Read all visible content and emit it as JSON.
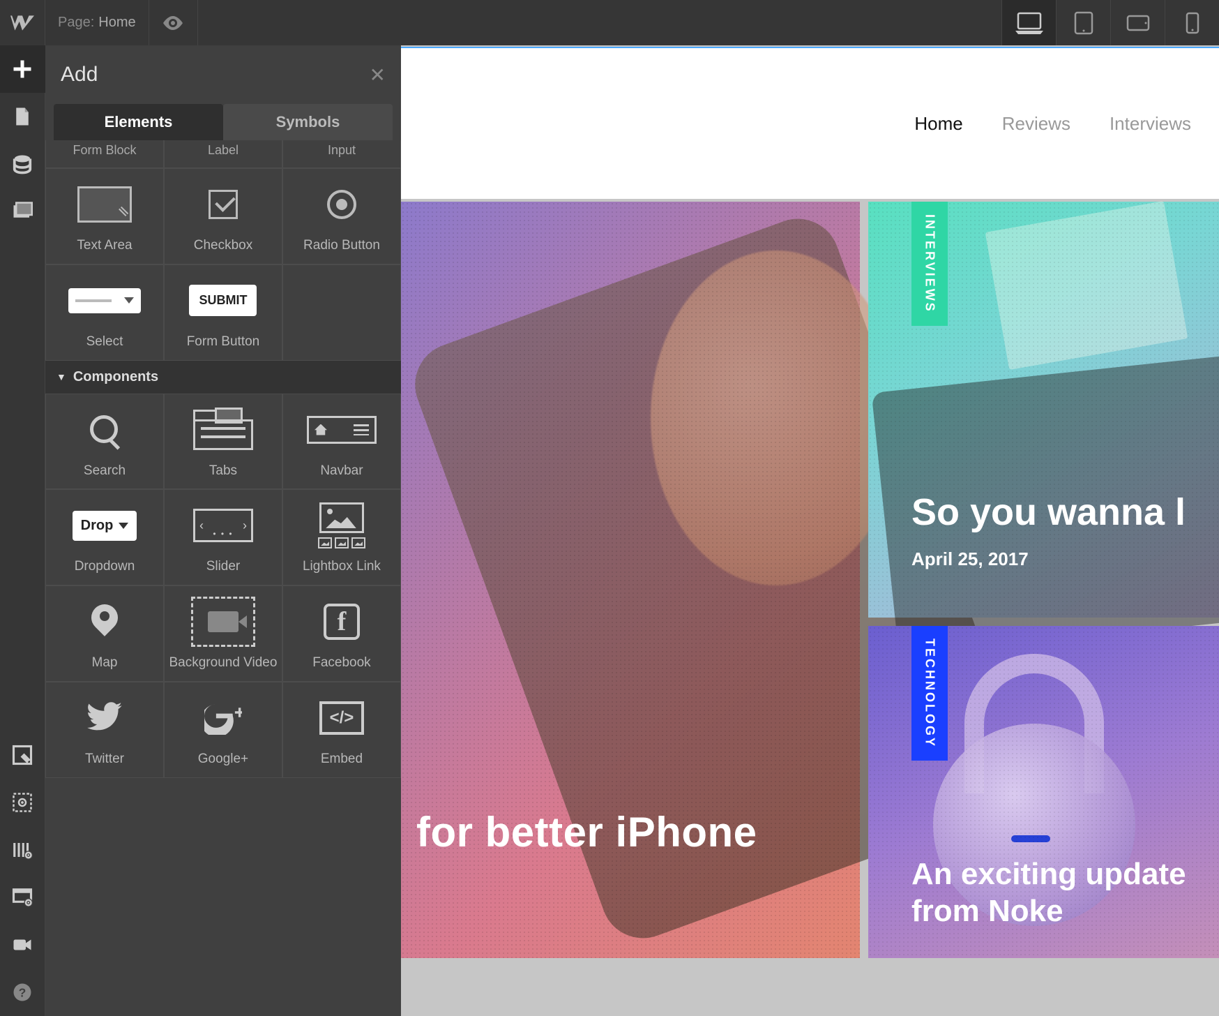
{
  "topbar": {
    "page_label_prefix": "Page:",
    "page_name": "Home"
  },
  "panel": {
    "title": "Add",
    "tabs": {
      "elements": "Elements",
      "symbols": "Symbols"
    },
    "row1": {
      "formblock": "Form Block",
      "label": "Label",
      "input": "Input"
    },
    "row2": {
      "textarea": "Text Area",
      "checkbox": "Checkbox",
      "radio": "Radio Button"
    },
    "row3": {
      "select": "Select",
      "formbutton": "Form Button",
      "submit_text": "SUBMIT"
    },
    "section_components": "Components",
    "row4": {
      "search": "Search",
      "tabs": "Tabs",
      "navbar": "Navbar"
    },
    "row5": {
      "dropdown": "Dropdown",
      "dropdown_btn": "Drop",
      "slider": "Slider",
      "lightbox": "Lightbox Link"
    },
    "row6": {
      "map": "Map",
      "bgvideo": "Background Video",
      "facebook": "Facebook"
    },
    "row7": {
      "twitter": "Twitter",
      "gplus": "Google+",
      "embed": "Embed"
    }
  },
  "site": {
    "nav": {
      "home": "Home",
      "reviews": "Reviews",
      "interviews": "Interviews"
    },
    "hero": {
      "headline": "for better iPhone"
    },
    "card1": {
      "tag": "INTERVIEWS",
      "headline": "So you wanna l",
      "date": "April 25, 2017"
    },
    "card2": {
      "tag": "TECHNOLOGY",
      "headline": "An exciting update from Noke"
    }
  }
}
